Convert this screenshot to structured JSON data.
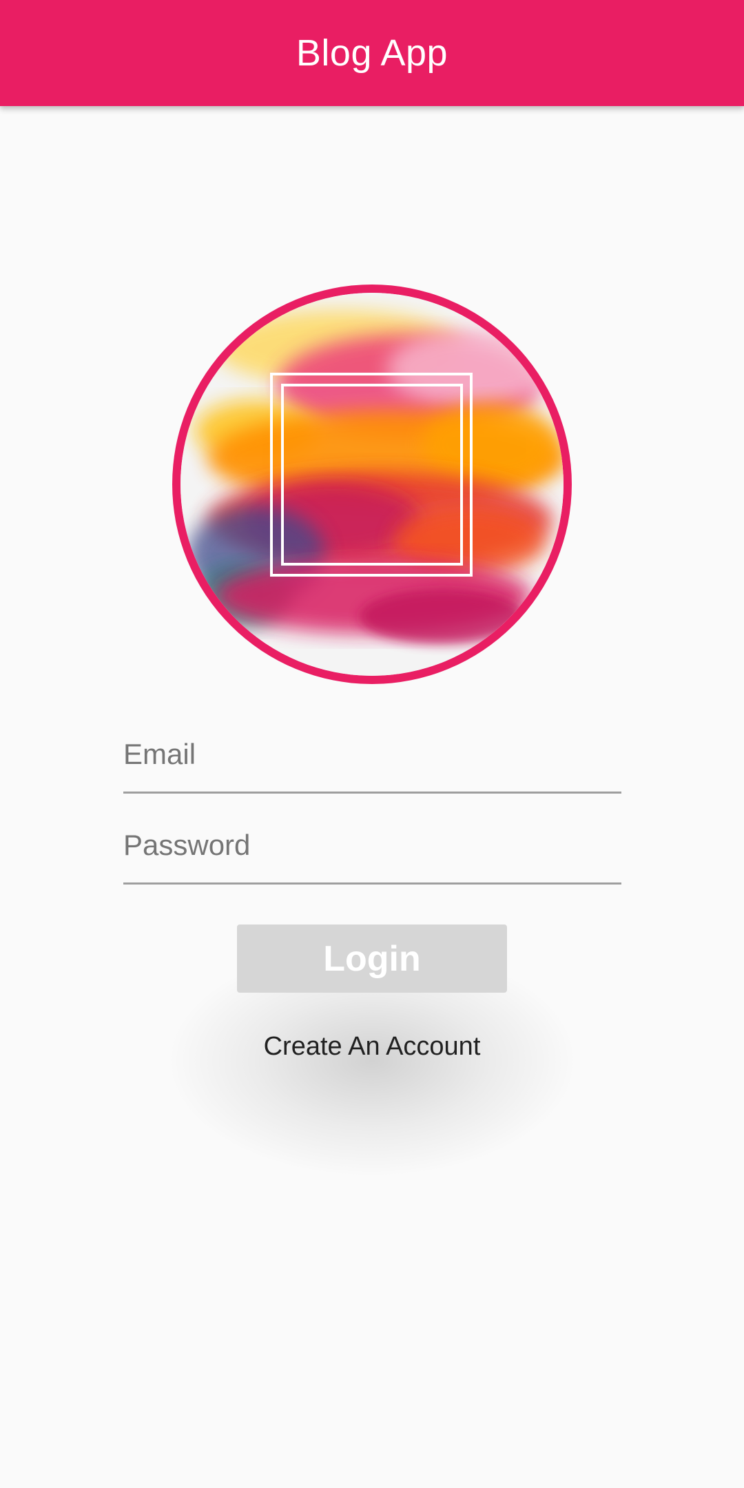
{
  "app_bar": {
    "title": "Blog App",
    "color": "#e91e63"
  },
  "avatar": {
    "icon": "watercolor-logo-image",
    "border_color": "#e91e63"
  },
  "form": {
    "email_placeholder": "Email",
    "password_placeholder": "Password",
    "login_label": "Login",
    "create_account_label": "Create An Account"
  }
}
